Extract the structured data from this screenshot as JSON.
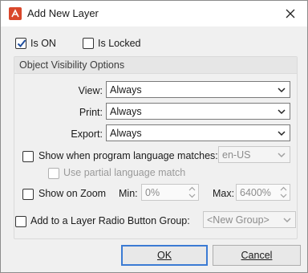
{
  "window": {
    "title": "Add New Layer"
  },
  "top": {
    "is_on_label": "Is ON",
    "is_on_checked": true,
    "is_locked_label": "Is Locked",
    "is_locked_checked": false
  },
  "group": {
    "title": "Object Visibility Options",
    "view_label": "View:",
    "view_value": "Always",
    "print_label": "Print:",
    "print_value": "Always",
    "export_label": "Export:",
    "export_value": "Always",
    "lang_match_label": "Show when program language matches:",
    "lang_value": "en-US",
    "partial_label": "Use partial language match",
    "zoom_label": "Show on Zoom",
    "min_label": "Min:",
    "min_value": "0%",
    "max_label": "Max:",
    "max_value": "6400%"
  },
  "radio_group": {
    "label": "Add to a Layer Radio Button Group:",
    "value": "<New Group>"
  },
  "buttons": {
    "ok": "OK",
    "cancel": "Cancel"
  },
  "colors": {
    "accent": "#3b7bd4",
    "check": "#1f4e9e",
    "icon_red": "#d9472b"
  }
}
